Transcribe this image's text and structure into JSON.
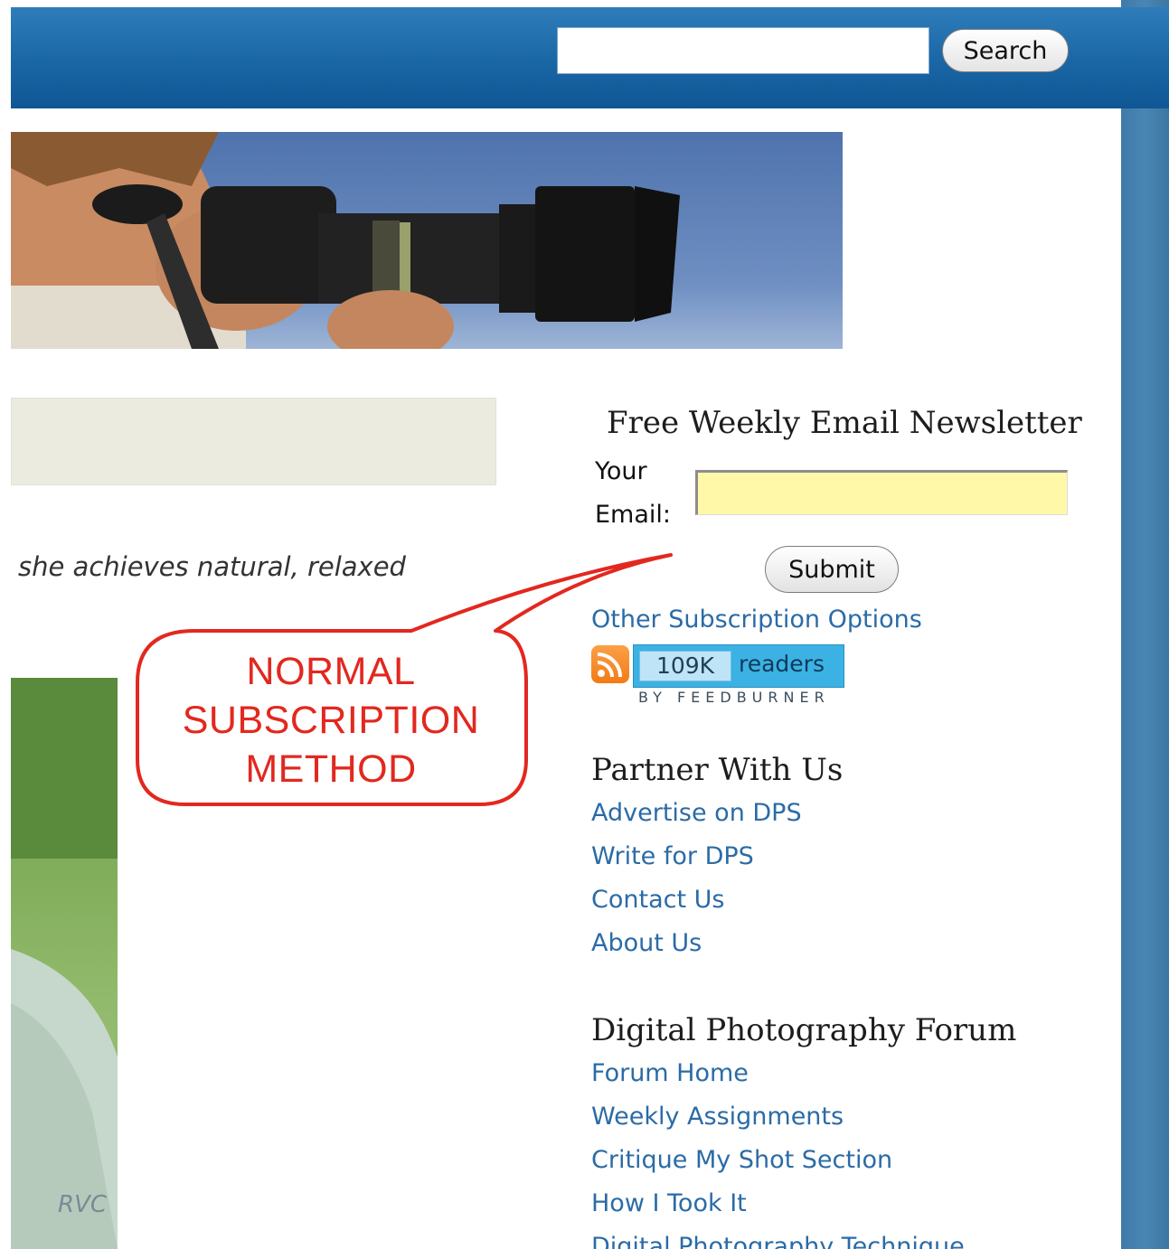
{
  "header": {
    "search_value": "",
    "search_button": "Search"
  },
  "content": {
    "excerpt": "she achieves natural, relaxed",
    "photo_watermark": "RVC"
  },
  "annotation": {
    "callout_lines": [
      "NORMAL",
      "SUBSCRIPTION",
      "METHOD"
    ],
    "color": "#e2281f"
  },
  "newsletter": {
    "heading": "Free Weekly Email Newsletter",
    "label_line1": "Your",
    "label_line2": "Email:",
    "email_value": "",
    "submit_label": "Submit",
    "other_options": "Other Subscription Options"
  },
  "feedburner": {
    "count": "109K",
    "readers": "readers",
    "byline": "BY FEEDBURNER"
  },
  "partner": {
    "heading": "Partner With Us",
    "links": [
      "Advertise on DPS",
      "Write for DPS",
      "Contact Us",
      "About Us"
    ]
  },
  "forum": {
    "heading": "Digital Photography Forum",
    "links": [
      "Forum Home",
      "Weekly Assignments",
      "Critique My Shot Section",
      "How I Took It",
      "Digital Photography Technique"
    ]
  },
  "colors": {
    "header_blue": "#1a66a5",
    "link_blue": "#2b6ba6",
    "email_field_yellow": "#fff8a8",
    "feedburner_blue": "#3cb2e4"
  }
}
